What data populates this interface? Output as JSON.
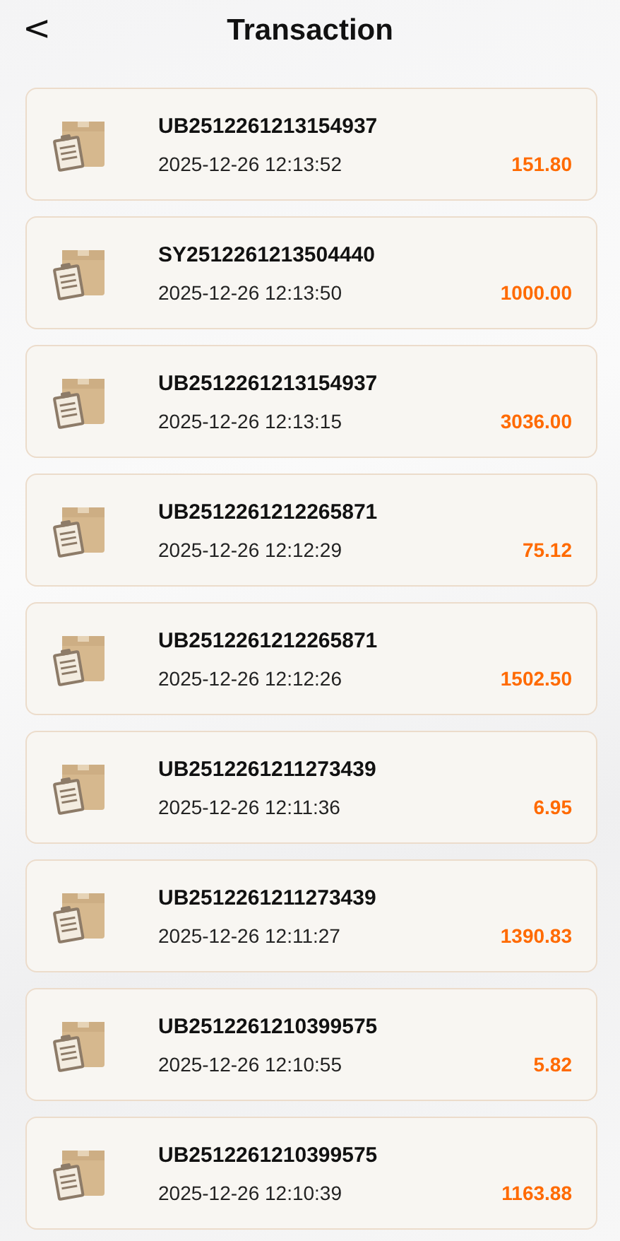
{
  "header": {
    "back": "<",
    "title": "Transaction"
  },
  "transactions": [
    {
      "id": "UB2512261213154937",
      "time": "2025-12-26 12:13:52",
      "amount": "151.80"
    },
    {
      "id": "SY2512261213504440",
      "time": "2025-12-26 12:13:50",
      "amount": "1000.00"
    },
    {
      "id": "UB2512261213154937",
      "time": "2025-12-26 12:13:15",
      "amount": "3036.00"
    },
    {
      "id": "UB2512261212265871",
      "time": "2025-12-26 12:12:29",
      "amount": "75.12"
    },
    {
      "id": "UB2512261212265871",
      "time": "2025-12-26 12:12:26",
      "amount": "1502.50"
    },
    {
      "id": "UB2512261211273439",
      "time": "2025-12-26 12:11:36",
      "amount": "6.95"
    },
    {
      "id": "UB2512261211273439",
      "time": "2025-12-26 12:11:27",
      "amount": "1390.83"
    },
    {
      "id": "UB2512261210399575",
      "time": "2025-12-26 12:10:55",
      "amount": "5.82"
    },
    {
      "id": "UB2512261210399575",
      "time": "2025-12-26 12:10:39",
      "amount": "1163.88"
    }
  ]
}
